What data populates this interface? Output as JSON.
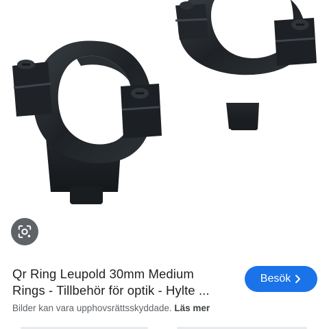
{
  "image": {
    "alt_icon": "scope-rings-image",
    "subject": "scope-mount-rings"
  },
  "lens": {
    "icon": "google-lens-icon"
  },
  "result": {
    "title_line1": "Qr Ring Leupold 30mm Medium",
    "title_line2": "Rings - Tillbehör för optik - Hylte ...",
    "copyright_text": "Bilder kan vara upphovsrättsskyddade.",
    "learn_more_label": "Läs mer"
  },
  "visit_button": {
    "label": "Besök",
    "icon": "chevron-right-icon",
    "color": "#1a73e8"
  },
  "colors": {
    "ring_dark": "#1c1f22",
    "ring_mid": "#2b3035",
    "ring_highlight": "#4a5058"
  }
}
